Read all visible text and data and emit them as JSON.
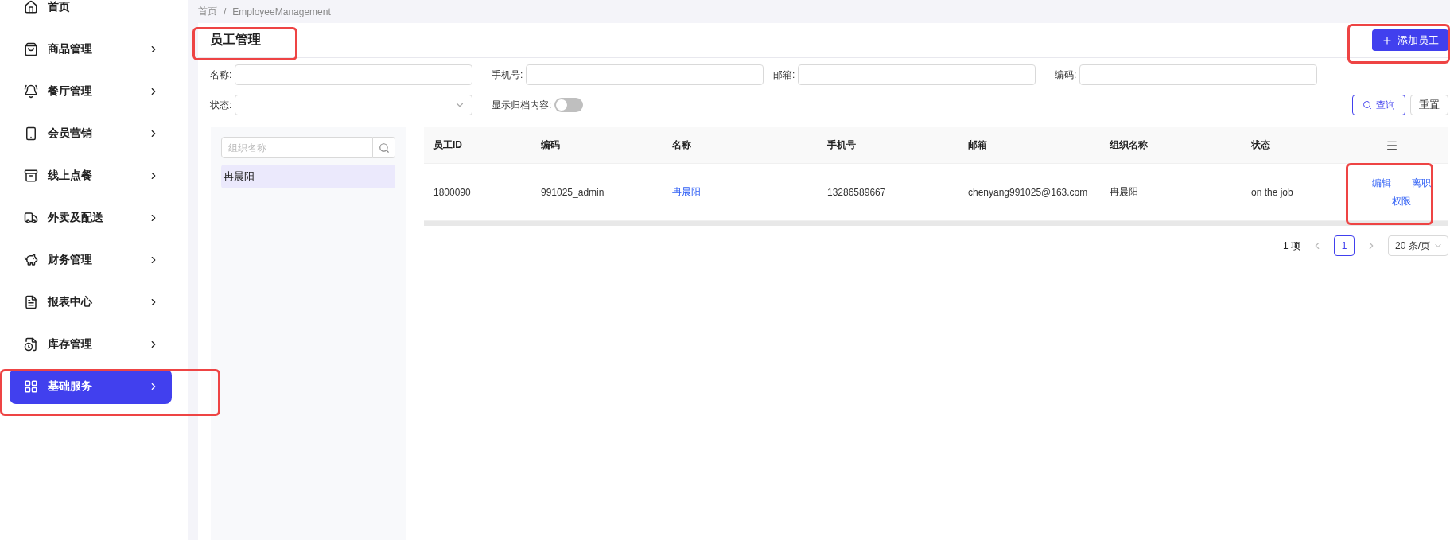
{
  "sidebar": {
    "items": [
      {
        "label": "首页",
        "expandable": false,
        "selected": false
      },
      {
        "label": "商品管理",
        "expandable": true,
        "selected": false
      },
      {
        "label": "餐厅管理",
        "expandable": true,
        "selected": false
      },
      {
        "label": "会员营销",
        "expandable": true,
        "selected": false
      },
      {
        "label": "线上点餐",
        "expandable": true,
        "selected": false
      },
      {
        "label": "外卖及配送",
        "expandable": true,
        "selected": false
      },
      {
        "label": "财务管理",
        "expandable": true,
        "selected": false
      },
      {
        "label": "报表中心",
        "expandable": true,
        "selected": false
      },
      {
        "label": "库存管理",
        "expandable": true,
        "selected": false
      },
      {
        "label": "基础服务",
        "expandable": true,
        "selected": true
      }
    ]
  },
  "breadcrumb": {
    "items": [
      "首页",
      "EmployeeManagement"
    ],
    "separator": "/"
  },
  "page_title": "员工管理",
  "add_button": "添加员工",
  "filters": [
    {
      "label": "名称:",
      "kind": "text"
    },
    {
      "label": "手机号:",
      "kind": "text"
    },
    {
      "label": "邮箱:",
      "kind": "text"
    },
    {
      "label": "编码:",
      "kind": "text"
    },
    {
      "label": "状态:",
      "kind": "select"
    },
    {
      "label": "显示归档内容:",
      "kind": "toggle",
      "on": false
    }
  ],
  "search_button": "查询",
  "reset_button": "重置",
  "org_panel": {
    "placeholder": "组织名称",
    "items": [
      {
        "label": "冉晨阳",
        "selected": true
      }
    ]
  },
  "table": {
    "columns": [
      "员工ID",
      "编码",
      "名称",
      "手机号",
      "邮箱",
      "组织名称",
      "状态"
    ],
    "rows": [
      {
        "cells": [
          "1800090",
          "991025_admin",
          "冉晨阳",
          "13286589667",
          "chenyang991025@163.com",
          "冉晨阳",
          "on the job"
        ],
        "actions": [
          "编辑",
          "离职",
          "权限"
        ]
      }
    ]
  },
  "pagination": {
    "total": "1 项",
    "pages": [
      {
        "label": "1",
        "selected": true
      }
    ],
    "page_size": "20 条/页"
  }
}
